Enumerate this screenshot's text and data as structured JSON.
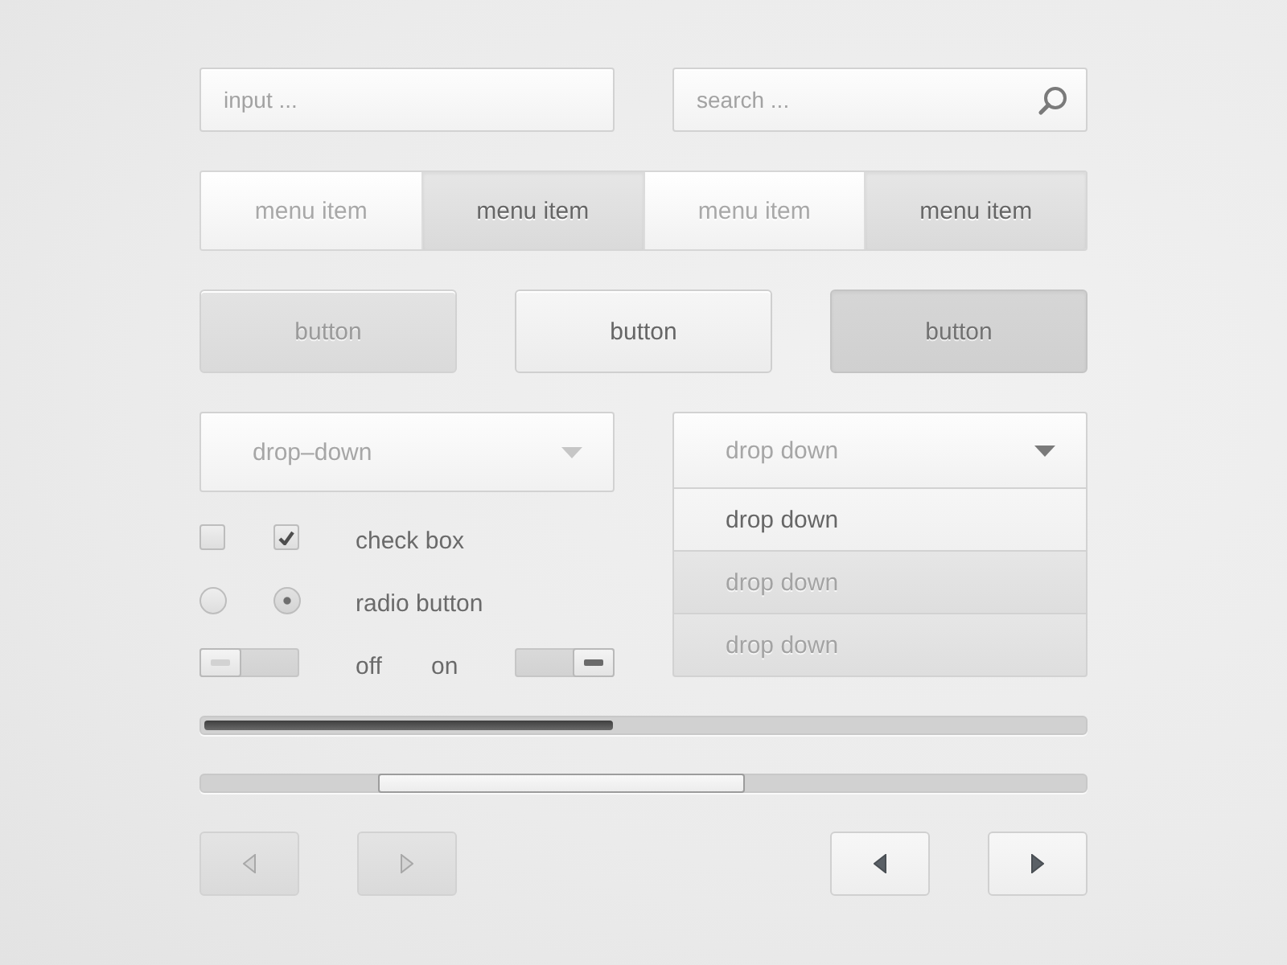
{
  "input": {
    "placeholder": "input ..."
  },
  "search": {
    "placeholder": "search ..."
  },
  "menu": [
    {
      "label": "menu item",
      "selected": false
    },
    {
      "label": "menu item",
      "selected": true
    },
    {
      "label": "menu item",
      "selected": false
    },
    {
      "label": "menu item",
      "selected": true
    }
  ],
  "buttons": [
    {
      "label": "button",
      "disabled": true,
      "pressed": false
    },
    {
      "label": "button",
      "disabled": false,
      "pressed": false
    },
    {
      "label": "button",
      "disabled": false,
      "pressed": true
    }
  ],
  "dropdowns": [
    {
      "label": "drop–down",
      "expanded": false
    },
    {
      "label": "drop down",
      "expanded": true,
      "options": [
        {
          "label": "drop down",
          "selected": true
        },
        {
          "label": "drop down",
          "selected": false
        },
        {
          "label": "drop down",
          "selected": false
        }
      ]
    }
  ],
  "checkboxes": {
    "label": "check box",
    "items": [
      {
        "checked": false
      },
      {
        "checked": true
      }
    ]
  },
  "radios": {
    "label": "radio button",
    "items": [
      {
        "selected": false
      },
      {
        "selected": true
      }
    ]
  },
  "toggles": {
    "labels": [
      "off",
      "on"
    ],
    "items": [
      {
        "on": false
      },
      {
        "on": true
      }
    ]
  },
  "progress": {
    "level": 0.466
  },
  "pager_buttons": [
    {
      "kind": "previous",
      "disabled": true
    },
    {
      "kind": "next",
      "disabled": true
    },
    {
      "kind": "previous",
      "disabled": false
    },
    {
      "kind": "next",
      "disabled": false
    }
  ]
}
